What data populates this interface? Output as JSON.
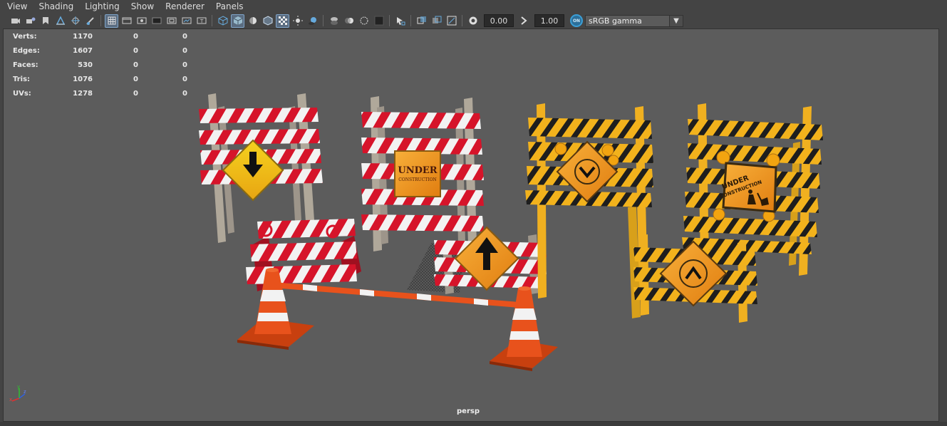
{
  "menu": [
    "View",
    "Shading",
    "Lighting",
    "Show",
    "Renderer",
    "Panels"
  ],
  "toolbar": {
    "exposure_value": "0.00",
    "gamma_value": "1.00",
    "color_space": "sRGB gamma",
    "color_mgmt_label": "ON"
  },
  "hud": {
    "rows": [
      {
        "label": "Verts:",
        "v1": "1170",
        "v2": "0",
        "v3": "0"
      },
      {
        "label": "Edges:",
        "v1": "1607",
        "v2": "0",
        "v3": "0"
      },
      {
        "label": "Faces:",
        "v1": "530",
        "v2": "0",
        "v3": "0"
      },
      {
        "label": "Tris:",
        "v1": "1076",
        "v2": "0",
        "v3": "0"
      },
      {
        "label": "UVs:",
        "v1": "1278",
        "v2": "0",
        "v3": "0"
      }
    ]
  },
  "viewport": {
    "camera": "persp",
    "signs": {
      "under_line1": "UNDER",
      "under_line2": "CONSTRUCTION",
      "under2_line1": "UNDER",
      "under2_line2": "CONSTRUCTION"
    },
    "axis": {
      "x": "x",
      "y": "y",
      "z": "z"
    }
  },
  "colors": {
    "ui_bg": "#444444",
    "viewport_bg": "#5c5c5c",
    "barrier_red": "#d6142a",
    "barrier_white": "#f2f2f2",
    "barrier_yellow": "#f2b21c",
    "barrier_black": "#1e1e1e",
    "cone_orange": "#e8521c",
    "sign_orange": "#f29a1a",
    "sign_yellow": "#f5d21e"
  }
}
